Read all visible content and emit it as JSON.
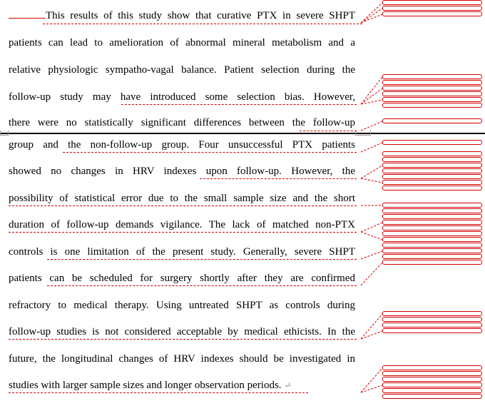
{
  "document": {
    "lines": [
      {
        "text": "This results of this study show that curative PTX in severe SHPT"
      },
      {
        "text": "patients can lead to amelioration of abnormal mineral metabolism and a"
      },
      {
        "text": "relative physiologic sympatho-vagal balance. Patient selection during the"
      },
      {
        "text": "follow-up study may have introduced some selection bias. However,"
      },
      {
        "text": "there were no statistically significant differences between the follow-up"
      },
      {
        "text": "group and the non-follow-up group. Four unsuccessful PTX patients"
      },
      {
        "text": "showed no changes in HRV indexes upon follow-up. However, the"
      },
      {
        "text": "possibility of statistical error due to the small sample size and the short"
      },
      {
        "text": "duration of follow-up demands vigilance. The lack of matched non-PTX"
      },
      {
        "text": "controls is one limitation of the present study. Generally, severe SHPT"
      },
      {
        "text": "patients can be scheduled for surgery shortly after they are confirmed"
      },
      {
        "text": "refractory to medical therapy. Using untreated SHPT as controls during"
      },
      {
        "text": "follow-up studies is not considered acceptable by medical ethicists. In the"
      },
      {
        "text": "future, the longitudinal changes of HRV indexes should be investigated in"
      },
      {
        "text": "studies with larger sample sizes and longer observation periods."
      }
    ],
    "paragraph_mark": "↵"
  }
}
